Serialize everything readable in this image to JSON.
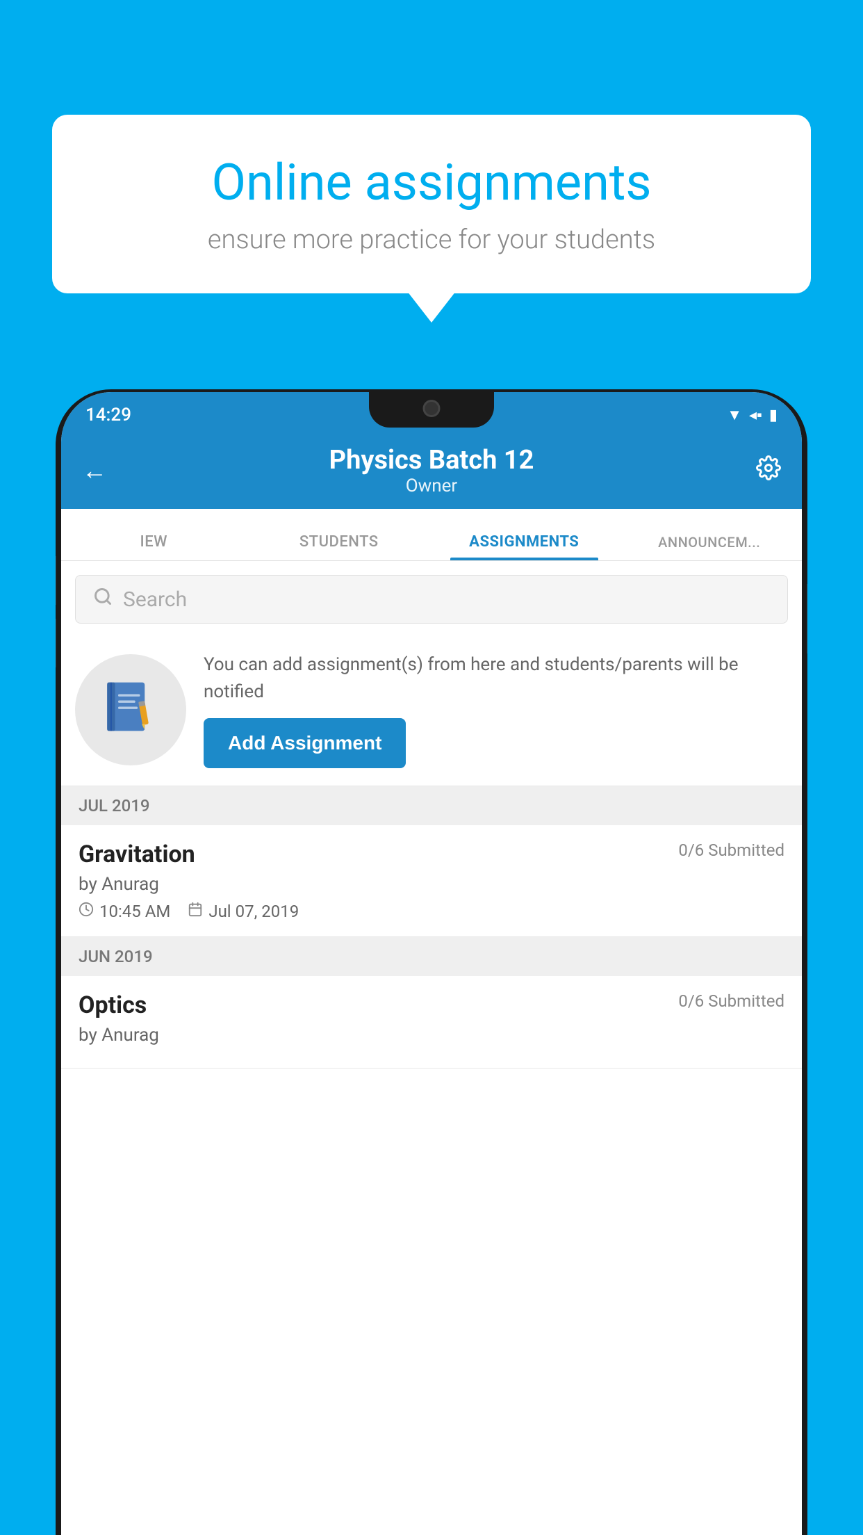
{
  "background_color": "#00AEEF",
  "speech_bubble": {
    "title": "Online assignments",
    "subtitle": "ensure more practice for your students"
  },
  "status_bar": {
    "time": "14:29",
    "wifi": "▼",
    "signal": "◀",
    "battery": "▮"
  },
  "app_header": {
    "title": "Physics Batch 12",
    "subtitle": "Owner",
    "back_label": "←",
    "settings_label": "⚙"
  },
  "tabs": [
    {
      "id": "iew",
      "label": "IEW",
      "active": false
    },
    {
      "id": "students",
      "label": "STUDENTS",
      "active": false
    },
    {
      "id": "assignments",
      "label": "ASSIGNMENTS",
      "active": true
    },
    {
      "id": "announcements",
      "label": "ANNOUNCEMENTS",
      "active": false
    }
  ],
  "search": {
    "placeholder": "Search"
  },
  "promo": {
    "description": "You can add assignment(s) from here and students/parents will be notified",
    "button_label": "Add Assignment"
  },
  "sections": [
    {
      "header": "JUL 2019",
      "assignments": [
        {
          "name": "Gravitation",
          "submitted": "0/6 Submitted",
          "author": "by Anurag",
          "time": "10:45 AM",
          "date": "Jul 07, 2019"
        }
      ]
    },
    {
      "header": "JUN 2019",
      "assignments": [
        {
          "name": "Optics",
          "submitted": "0/6 Submitted",
          "author": "by Anurag",
          "time": "",
          "date": ""
        }
      ]
    }
  ]
}
